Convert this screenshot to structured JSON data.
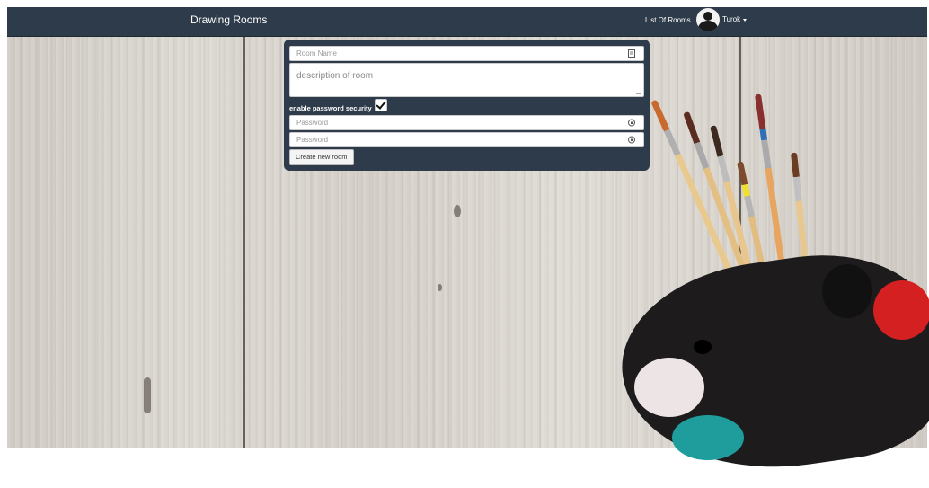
{
  "navbar": {
    "brand": "Drawing Rooms",
    "list_of_rooms": "List Of Rooms",
    "user_name": "Turok"
  },
  "form": {
    "room_name_placeholder": "Room Name",
    "description_placeholder": "description of room",
    "enable_password_label": "enable password security",
    "password_enabled": true,
    "password_placeholder": "Password",
    "confirm_password_placeholder": "Password",
    "create_button": "Create new room"
  },
  "colors": {
    "navbar_bg": "#2e3b4a",
    "panel_bg": "#2e3b4a"
  }
}
